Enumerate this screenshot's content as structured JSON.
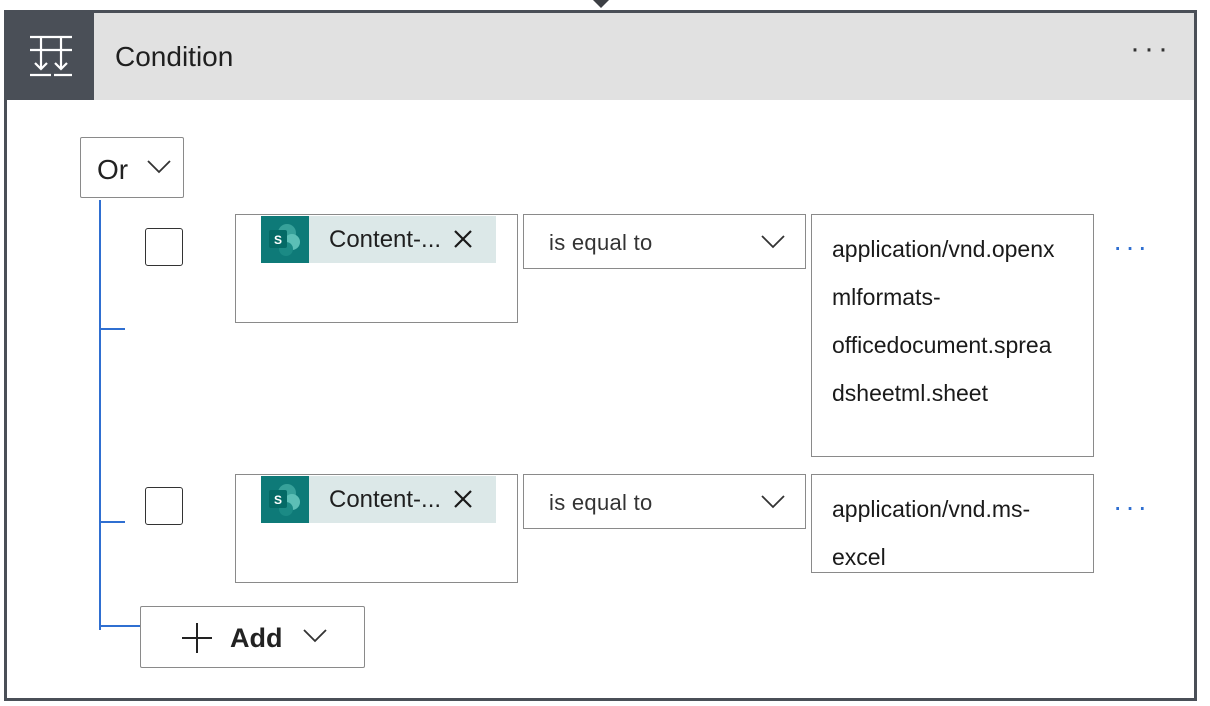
{
  "header": {
    "title": "Condition",
    "more_label": "···",
    "icon": "condition-branch-icon"
  },
  "group": {
    "operator": "Or"
  },
  "rows": [
    {
      "token": "Content-...",
      "operator": "is equal to",
      "value_lines": [
        "application/vnd.openx",
        "mlformats-",
        "officedocument.sprea",
        "dsheetml.sheet"
      ],
      "more_label": "···"
    },
    {
      "token": "Content-...",
      "operator": "is equal to",
      "value_lines": [
        "application/vnd.ms-",
        "excel"
      ],
      "more_label": "···"
    }
  ],
  "add": {
    "label": "Add"
  },
  "colors": {
    "header_bg": "#e1e1e1",
    "icon_box": "#4a4f57",
    "tree_line": "#2f6fd1",
    "sharepoint": "#0e7a78",
    "token_bg": "#dce8e8"
  }
}
